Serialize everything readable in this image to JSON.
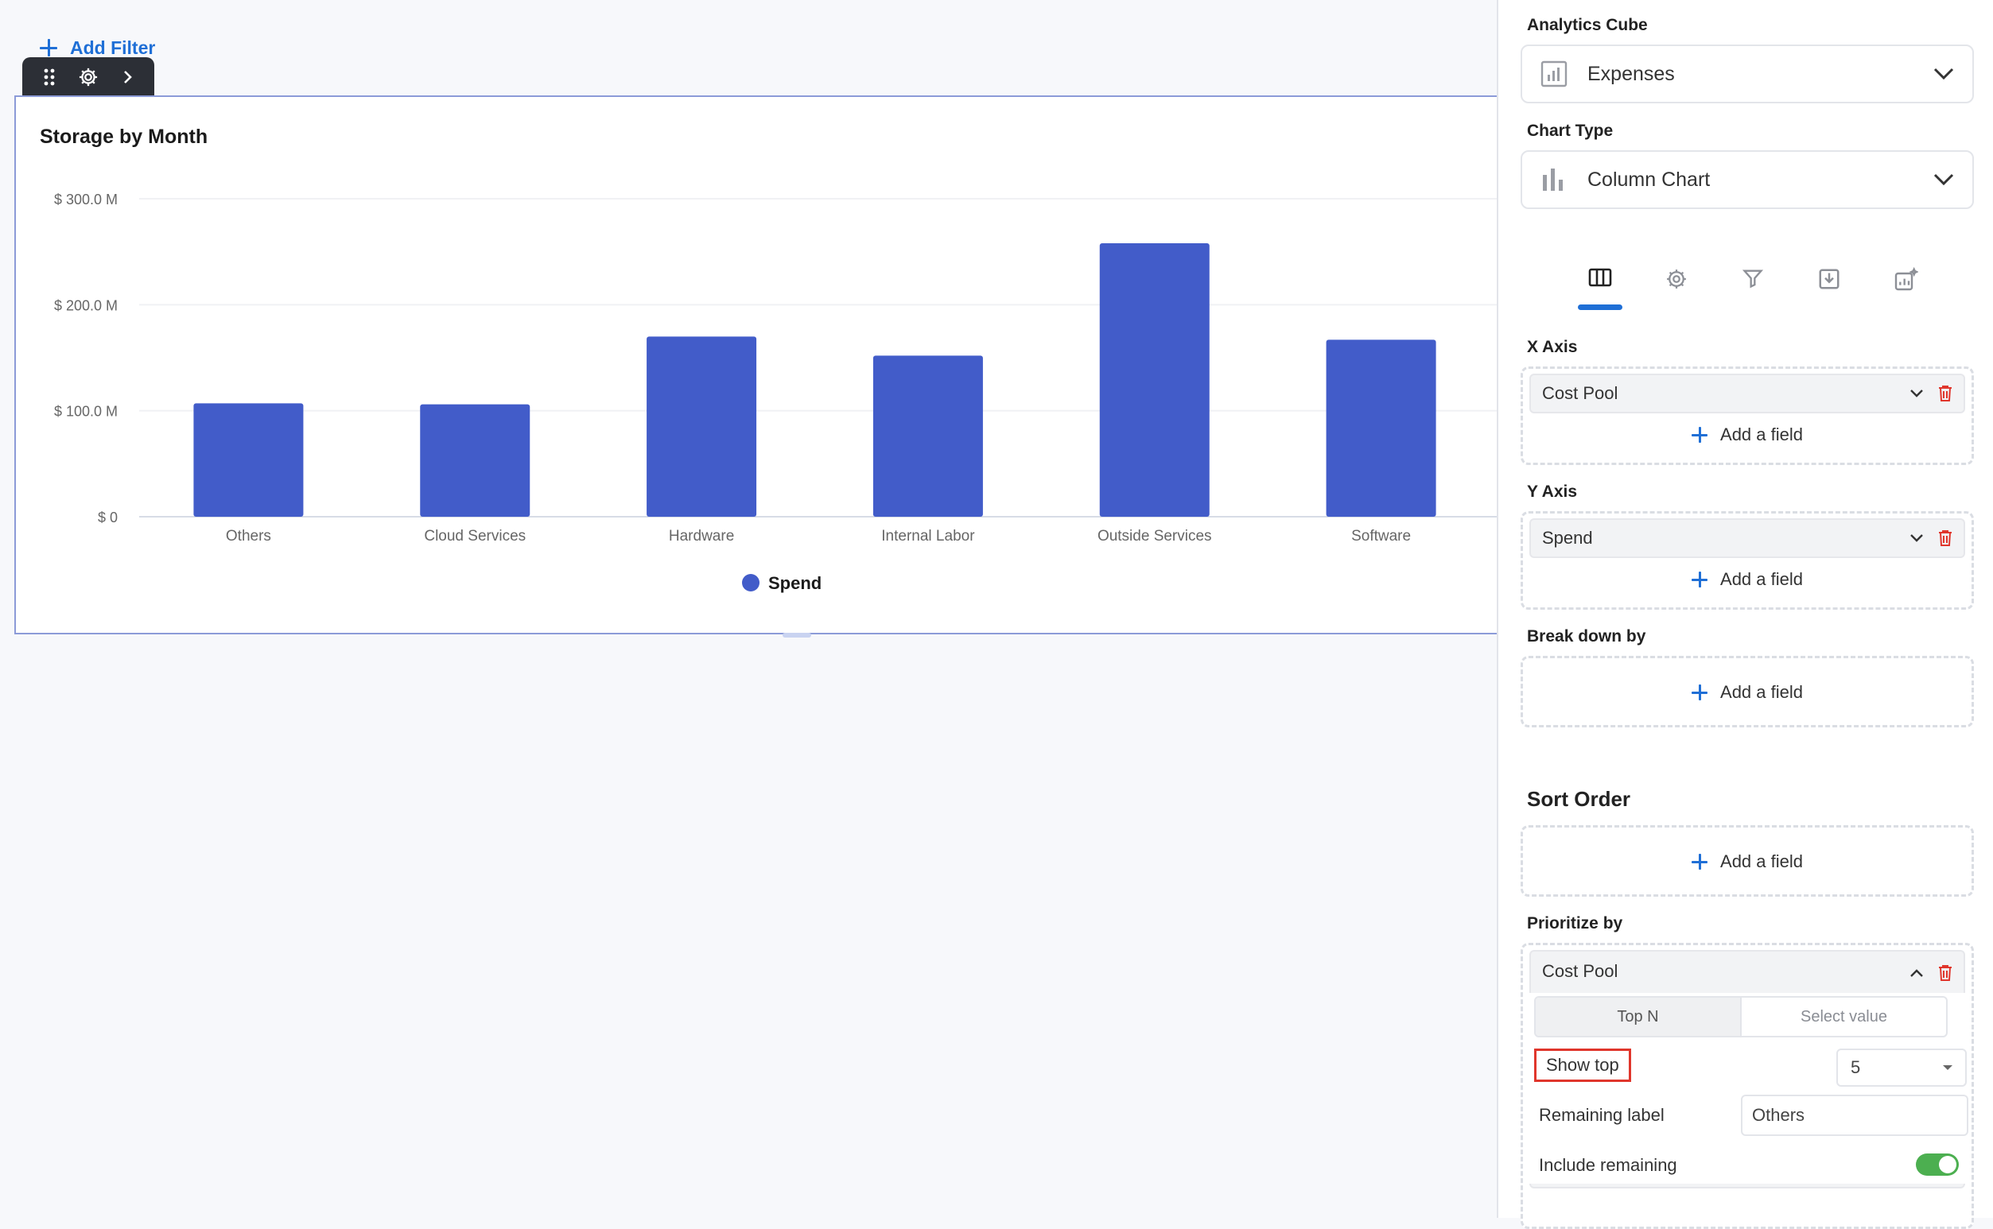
{
  "toolbar": {
    "add_filter_label": "Add Filter"
  },
  "chart": {
    "title": "Storage by Month",
    "legend_label": "Spend",
    "bar_color": "#425cc9"
  },
  "chart_data": {
    "type": "bar",
    "title": "Storage by Month",
    "categories": [
      "Others",
      "Cloud Services",
      "Hardware",
      "Internal Labor",
      "Outside Services",
      "Software"
    ],
    "series": [
      {
        "name": "Spend",
        "values": [
          107000000,
          106000000,
          170000000,
          152000000,
          258000000,
          167000000
        ]
      }
    ],
    "ylim": [
      0,
      300000000
    ],
    "yticks": [
      {
        "value": 0,
        "label": "$ 0"
      },
      {
        "value": 100000000,
        "label": "$ 100.0 M"
      },
      {
        "value": 200000000,
        "label": "$ 200.0 M"
      },
      {
        "value": 300000000,
        "label": "$ 300.0 M"
      }
    ],
    "legend": "bottom-center",
    "grid": true
  },
  "panel": {
    "cube_label": "Analytics Cube",
    "cube_value": "Expenses",
    "chart_type_label": "Chart Type",
    "chart_type_value": "Column Chart",
    "tabs": [
      "columns-icon",
      "gear-icon",
      "filter-icon",
      "download-icon",
      "ai-chart-icon"
    ],
    "x_axis": {
      "label": "X Axis",
      "field": "Cost Pool",
      "add": "Add a field"
    },
    "y_axis": {
      "label": "Y Axis",
      "field": "Spend",
      "add": "Add a field"
    },
    "breakdown": {
      "label": "Break down by",
      "add": "Add a field"
    },
    "sort": {
      "label": "Sort Order",
      "add": "Add a field"
    },
    "prioritize": {
      "label": "Prioritize by",
      "field": "Cost Pool",
      "seg_top": "Top N",
      "seg_select": "Select value",
      "show_top_label": "Show top",
      "show_top_value": "5",
      "remaining_label": "Remaining label",
      "remaining_value": "Others",
      "include_label": "Include remaining",
      "include_on": true
    },
    "accent": "#1f6fd6",
    "delete_color": "#e0362c"
  }
}
